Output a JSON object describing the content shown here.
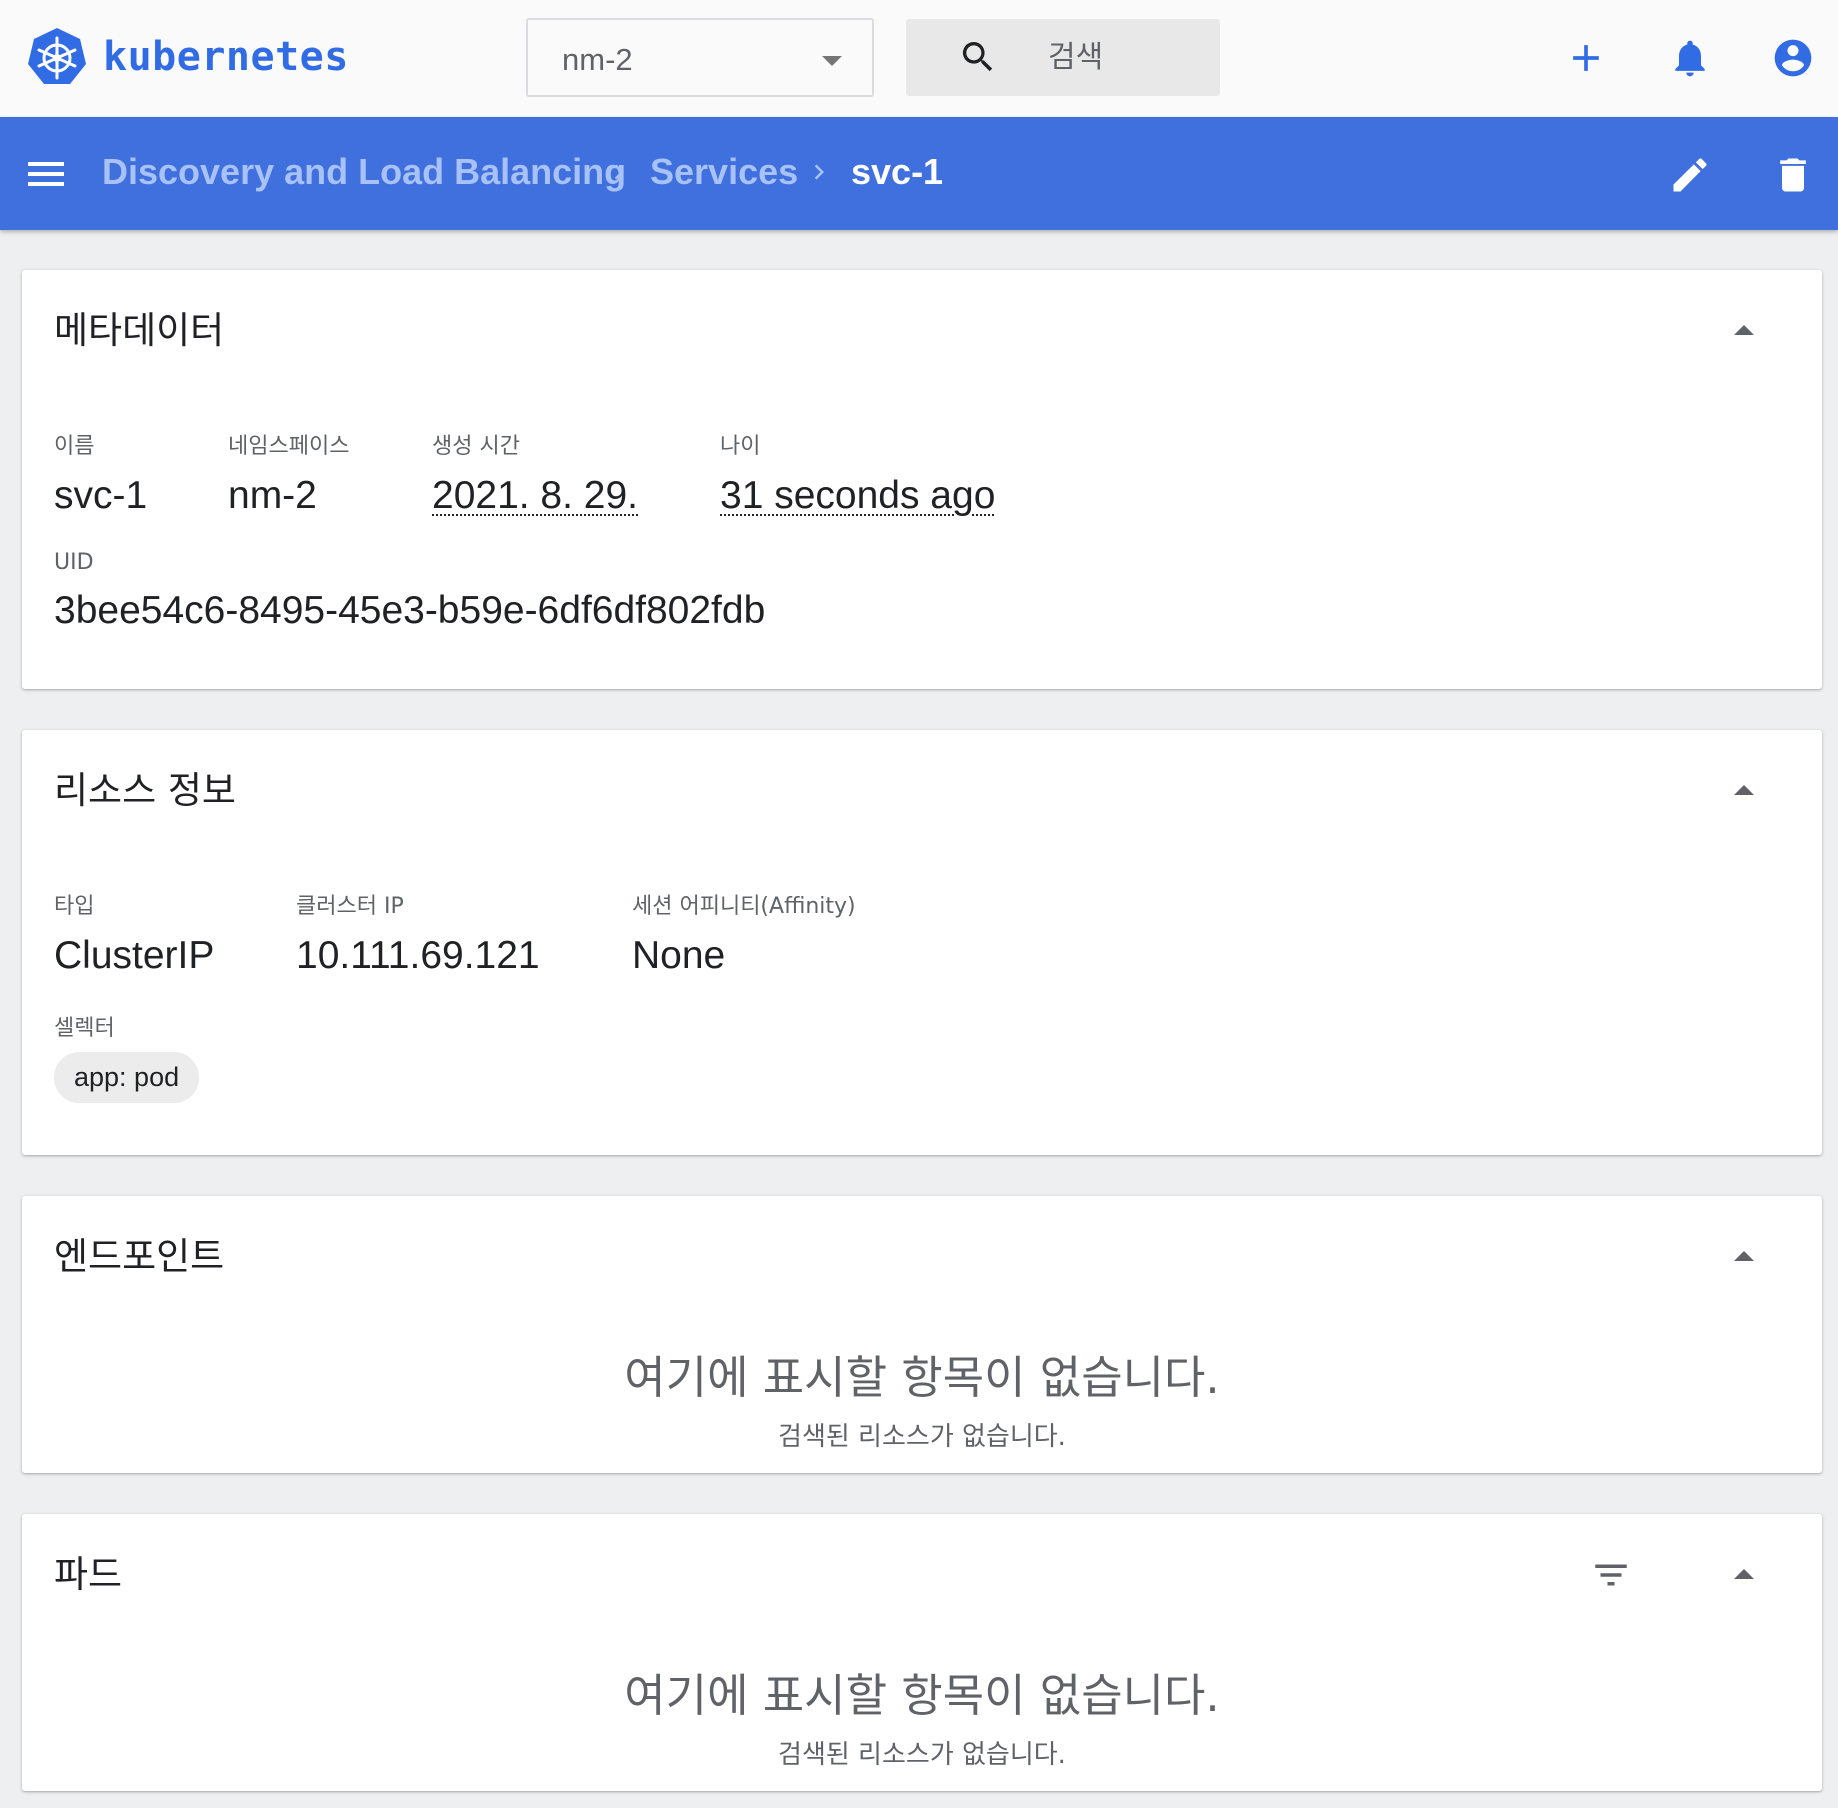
{
  "header": {
    "brand": "kubernetes",
    "namespace_selected": "nm-2",
    "search_placeholder": "검색",
    "icons": [
      "kubernetes-logo-icon",
      "chevron-down-icon",
      "search-icon",
      "add-icon",
      "bell-icon",
      "account-icon"
    ]
  },
  "breadcrumb": {
    "items": [
      "Discovery and Load Balancing",
      "Services",
      "svc-1"
    ],
    "icons": [
      "menu-icon",
      "chevron-right-icon",
      "edit-icon",
      "delete-icon"
    ]
  },
  "metadata": {
    "title": "메타데이터",
    "name_label": "이름",
    "name_value": "svc-1",
    "namespace_label": "네임스페이스",
    "namespace_value": "nm-2",
    "created_label": "생성 시간",
    "created_value": "2021. 8. 29.",
    "age_label": "나이",
    "age_value": "31 seconds ago",
    "uid_label": "UID",
    "uid_value": "3bee54c6-8495-45e3-b59e-6df6df802fdb"
  },
  "resource": {
    "title": "리소스 정보",
    "type_label": "타입",
    "type_value": "ClusterIP",
    "cluster_ip_label": "클러스터 IP",
    "cluster_ip_value": "10.111.69.121",
    "affinity_label": "세션 어피니티(Affinity)",
    "affinity_value": "None",
    "selector_label": "셀렉터",
    "selector_chip": "app: pod"
  },
  "endpoints": {
    "title": "엔드포인트",
    "empty_title": "여기에 표시할 항목이 없습니다.",
    "empty_sub": "검색된 리소스가 없습니다."
  },
  "pods": {
    "title": "파드",
    "empty_title": "여기에 표시할 항목이 없습니다.",
    "empty_sub": "검색된 리소스가 없습니다."
  },
  "colors": {
    "brand_blue": "#326ce5",
    "action_bar": "#3f70de",
    "page_bg": "#eeeff1"
  }
}
